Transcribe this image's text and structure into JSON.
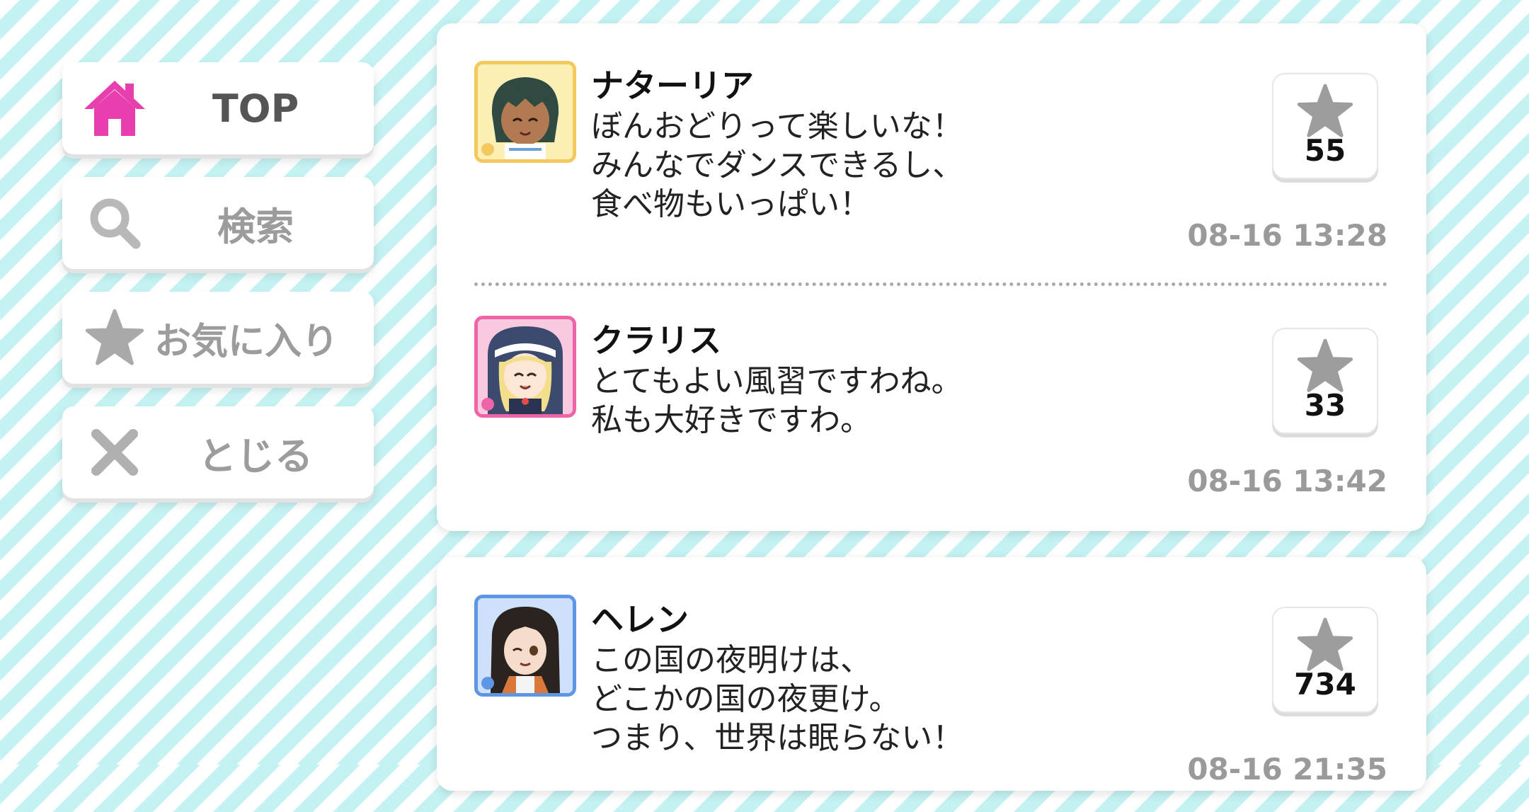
{
  "nav": {
    "top_label": "TOP",
    "search_label": "検索",
    "favorites_label": "お気に入り",
    "close_label": "とじる"
  },
  "colors": {
    "accent_pink": "#e83fae",
    "muted_gray": "#9c9c9c",
    "avatar_frame_yellow": "#f3c95e",
    "avatar_frame_pink": "#ef63a9",
    "avatar_frame_blue": "#5e96e6"
  },
  "cards": [
    {
      "posts": [
        {
          "name": "ナターリア",
          "lines": [
            "ぼんおどりって楽しいな！",
            "みんなでダンスできるし、",
            "食べ物もいっぱい！"
          ],
          "likes": "55",
          "time": "08-16 13:28",
          "avatar_icon": "avatar-natalia-icon"
        },
        {
          "name": "クラリス",
          "lines": [
            "とてもよい風習ですわね。",
            "私も大好きですわ。"
          ],
          "likes": "33",
          "time": "08-16 13:42",
          "avatar_icon": "avatar-clarice-icon"
        }
      ]
    },
    {
      "posts": [
        {
          "name": "ヘレン",
          "lines": [
            "この国の夜明けは、",
            "どこかの国の夜更け。",
            "つまり、世界は眠らない！"
          ],
          "likes": "734",
          "time": "08-16 21:35",
          "avatar_icon": "avatar-helen-icon"
        }
      ]
    }
  ]
}
